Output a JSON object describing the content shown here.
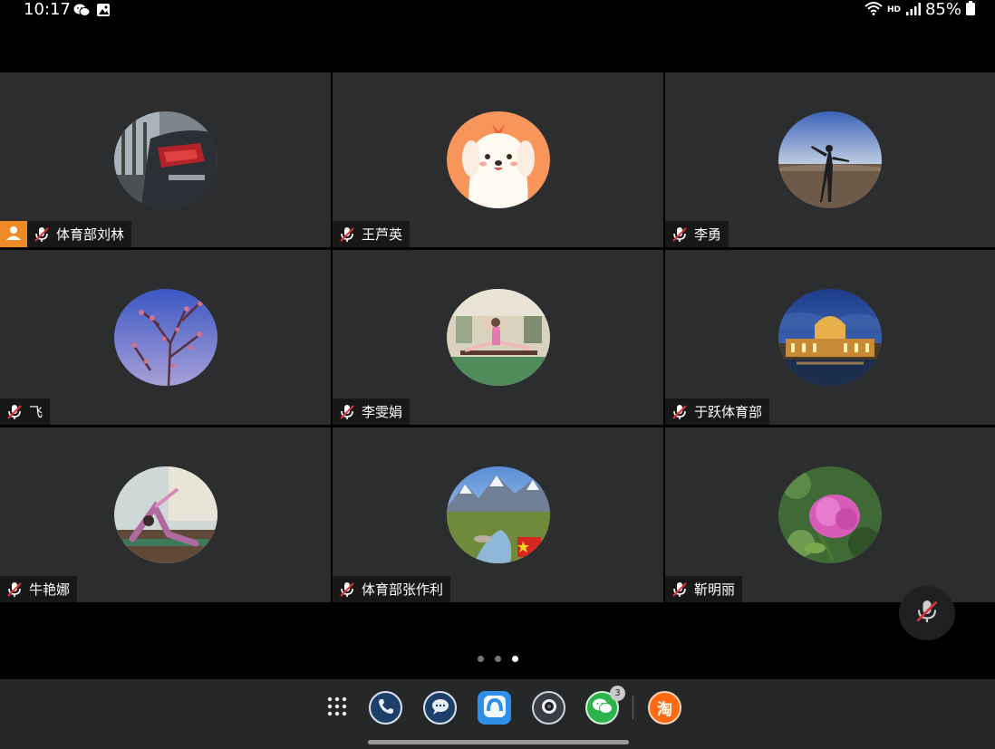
{
  "status_bar": {
    "time": "10:17",
    "network": "HD",
    "battery": "85%"
  },
  "participants": [
    {
      "name": "体育部刘林",
      "host": true,
      "mic": "muted",
      "avatar": "car-tail-light"
    },
    {
      "name": "王芦英",
      "host": false,
      "mic": "muted",
      "avatar": "cartoon-dog"
    },
    {
      "name": "李勇",
      "host": false,
      "mic": "muted",
      "avatar": "person-silhouette-desert"
    },
    {
      "name": "飞",
      "host": false,
      "mic": "muted",
      "avatar": "blossom-branches"
    },
    {
      "name": "李雯娟",
      "host": false,
      "mic": "muted",
      "avatar": "gymnast-split"
    },
    {
      "name": "于跃体育部",
      "host": false,
      "mic": "muted",
      "avatar": "palace-night"
    },
    {
      "name": "牛艳娜",
      "host": false,
      "mic": "muted",
      "avatar": "yoga-pose"
    },
    {
      "name": "体育部张作利",
      "host": false,
      "mic": "muted",
      "avatar": "mountain-lake"
    },
    {
      "name": "靳明丽",
      "host": false,
      "mic": "muted",
      "avatar": "pink-flower"
    }
  ],
  "pager": {
    "pages": 3,
    "current": 3
  },
  "dock": {
    "apps": [
      "apps-grid-icon",
      "phone-icon",
      "messages-icon",
      "browser-icon",
      "camera-icon",
      "wechat-icon",
      "taobao-icon"
    ],
    "wechat_badge": "3",
    "taobao_label": "淘"
  },
  "colors": {
    "tile_bg": "#2c2d2f",
    "host_badge": "#f08a24",
    "dock_bg": "#262729"
  }
}
